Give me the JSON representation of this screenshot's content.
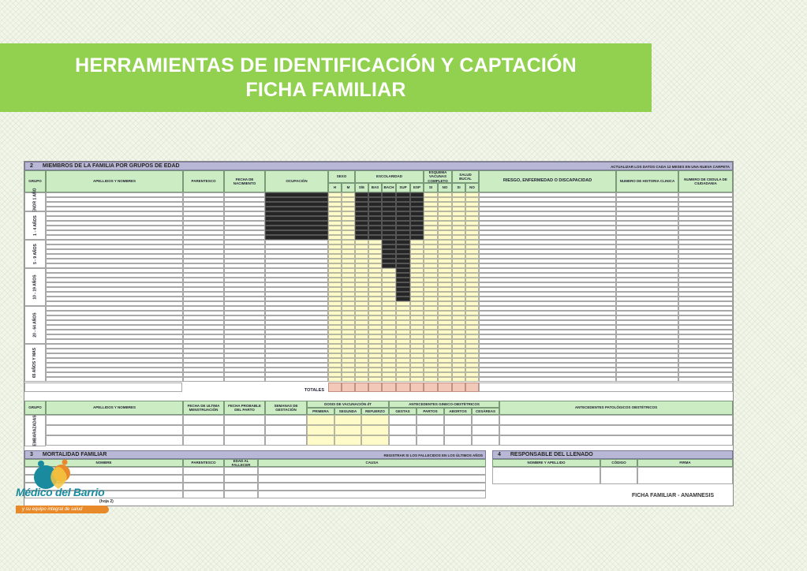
{
  "title": {
    "line1": "HERRAMIENTAS DE  IDENTIFICACIÓN Y CAPTACIÓN",
    "line2": "FICHA FAMILIAR"
  },
  "section2": {
    "number": "2",
    "title": "MIEMBROS DE LA FAMILIA POR GRUPOS DE EDAD",
    "note": "ACTUALIZAR LOS DATOS CADA 12 MESES EN UNA NUEVA CARPETA",
    "headers": {
      "grupo": "GRUPO",
      "apellidos": "APELLIDOS Y NOMBRES",
      "parentesco": "PARENTESCO",
      "fecha_nac": "FECHA DE NACIMIENTO",
      "ocupacion": "OCUPACIÓN",
      "sexo": "SEXO",
      "escolaridad": "ESCOLARIDAD",
      "esquema": "ESQUEMA VACUNAS COMPLETO",
      "salud_bucal": "SALUD BUCAL",
      "riesgo": "RIESGO, ENFERMEDAD O DISCAPACIDAD",
      "historia": "NUMERO DE HISTORIA CLINICA",
      "cedula": "NUMERO DE CEDULA DE CIUDADANIA"
    },
    "subheaders": [
      "H",
      "M",
      "S/E",
      "BAS",
      "BACH",
      "SUP",
      "ESP",
      "SI",
      "NO",
      "SI",
      "NO"
    ],
    "groups": [
      "MENOR 1 AÑO",
      "1 - 4 AÑOS",
      "5 - 9 AÑOS",
      "10 - 19 AÑOS",
      "20 - 64 AÑOS",
      "65 AÑOS Y MAS"
    ],
    "totales": "TOTALES"
  },
  "embarazadas": {
    "grupo": "GRUPO",
    "label": "EMBARAZADAS",
    "apellidos": "APELLIDOS Y NOMBRES",
    "fum": "FECHA DE ULTIMA MENSTRUACIÓN",
    "fpp": "FECHA PROBABLE DEL PARTO",
    "semanas": "SEMANAS DE GESTACIÓN",
    "dosis": "DOSIS DE VACUNACIÓN dT",
    "dosis_sub": [
      "PRIMERA",
      "SEGUNDA",
      "REFUERZO"
    ],
    "gineco": "ANTECEDENTES GINECO-OBSTÉTRICOS",
    "gineco_sub": [
      "GESTAS",
      "PARTOS",
      "ABORTOS",
      "CESÁREAS"
    ],
    "patologicos": "ANTECEDENTES PATOLÓGICOS OBSTÉTRICOS"
  },
  "section3": {
    "number": "3",
    "title": "MORTALIDAD FAMILIAR",
    "note": "REGISTRAR SI LOS FALLECIDOS EN LOS ÚLTIMOS AÑOS",
    "headers": [
      "NOMBRE",
      "PARENTESCO",
      "EDAD AL FALLECER",
      "CAUSA"
    ]
  },
  "section4": {
    "number": "4",
    "title": "RESPONSABLE DEL LLENADO",
    "headers": [
      "NOMBRE Y APELLIDO",
      "CÓDIGO",
      "FIRMA"
    ]
  },
  "footer": {
    "form_name": "FICHA FAMILIAR - ANAMNESIS",
    "page_note": "(hoja 2)"
  },
  "logo": {
    "name": "Médico del Barrio",
    "tagline": "y su equipo integral de salud"
  },
  "colors": {
    "banner": "#92d050",
    "header_fill": "#ccecc4",
    "section_fill": "#b8b8d6",
    "yellow_cells": "#fffbc8",
    "blocked_cells": "#262626",
    "totals_fill": "#f2c9b8"
  }
}
